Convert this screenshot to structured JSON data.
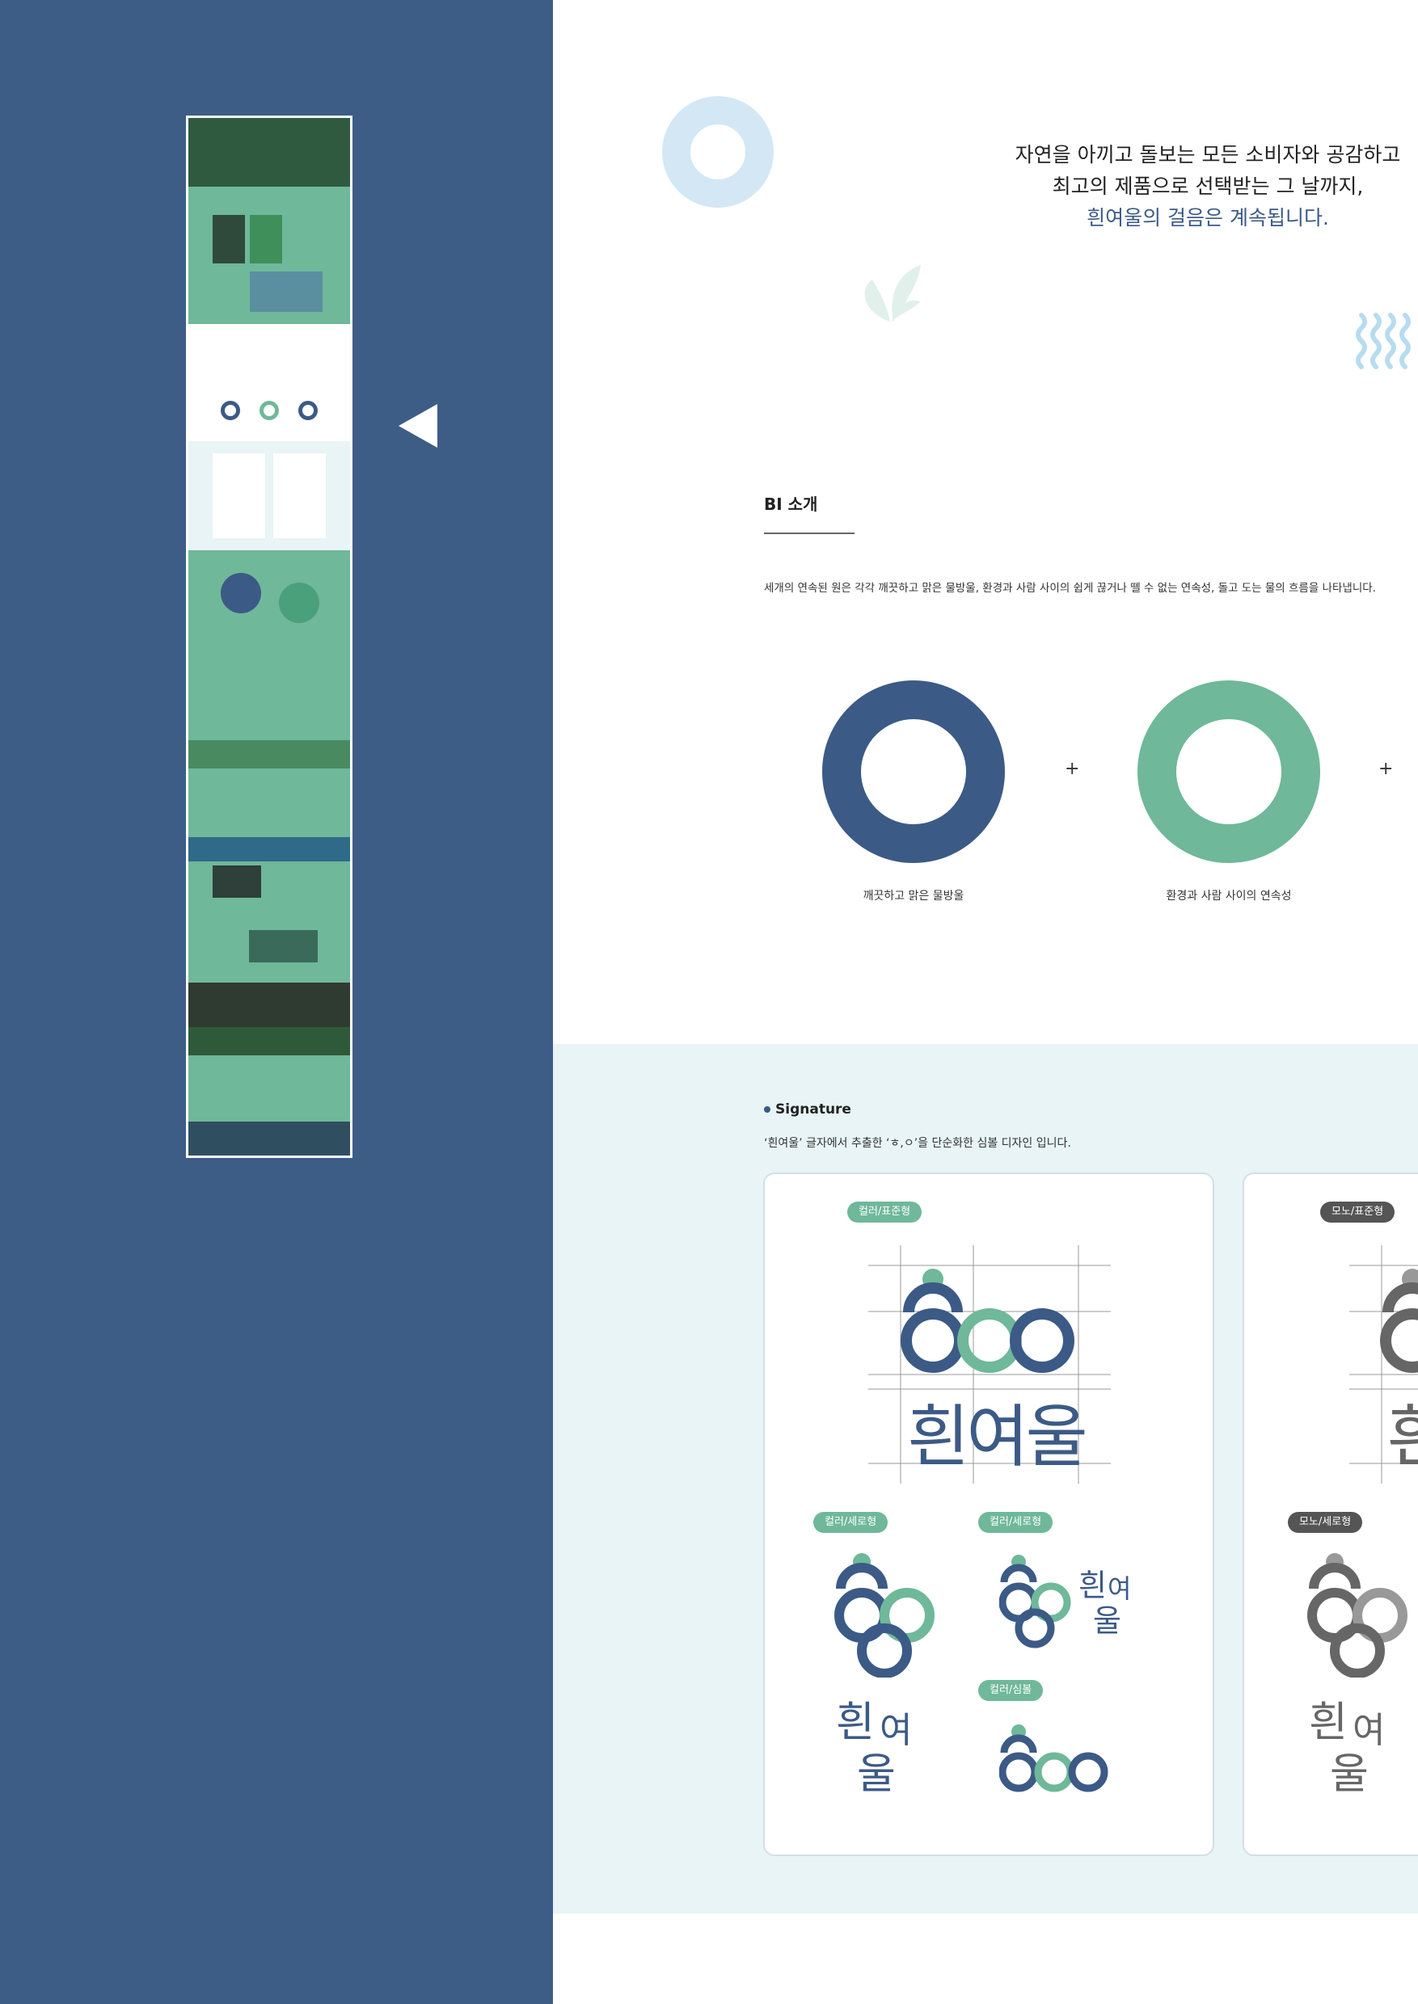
{
  "colors": {
    "navy": "#3c5a86",
    "green": "#6fb89a",
    "light_blue": "#d3e7f5",
    "signature_bg": "#e8f4f5",
    "mono_gray": "#666666"
  },
  "nav": {
    "prev_icon": "arrow-left-icon"
  },
  "intro": {
    "line1": "자연을 아끼고 돌보는 모든 소비자와 공감하고",
    "line2": "최고의 제품으로 선택받는 그 날까지,",
    "line3": "흰여울의 걸음은 계속됩니다."
  },
  "bi": {
    "title": "BI 소개",
    "description": "세개의 연속된 원은 각각 깨끗하고 맑은 물방울, 환경과 사람 사이의 쉽게 끊거나 뗄 수 없는 연속성, 돌고 도는 물의 흐름을 나타냅니다.",
    "circles": [
      {
        "label": "깨끗하고 맑은 물방울"
      },
      {
        "label": "환경과 사람 사이의 연속성"
      }
    ],
    "plus": "+"
  },
  "signature": {
    "title": "Signature",
    "description": "‘흰여울’ 글자에서 추출한 ‘ㅎ,ㅇ’을 단순화한 심볼 디자인 입니다.",
    "wordmark": "흰여울",
    "wordmark_v1": "흰",
    "wordmark_v2": "여",
    "wordmark_v3": "울",
    "color_card": {
      "standard": "컬러/표준형",
      "vertical": "컬러/세로형",
      "vertical2": "컬러/세로형",
      "symbol": "컬러/심볼"
    },
    "mono_card": {
      "standard": "모노/표준형",
      "vertical": "모노/세로형"
    }
  }
}
